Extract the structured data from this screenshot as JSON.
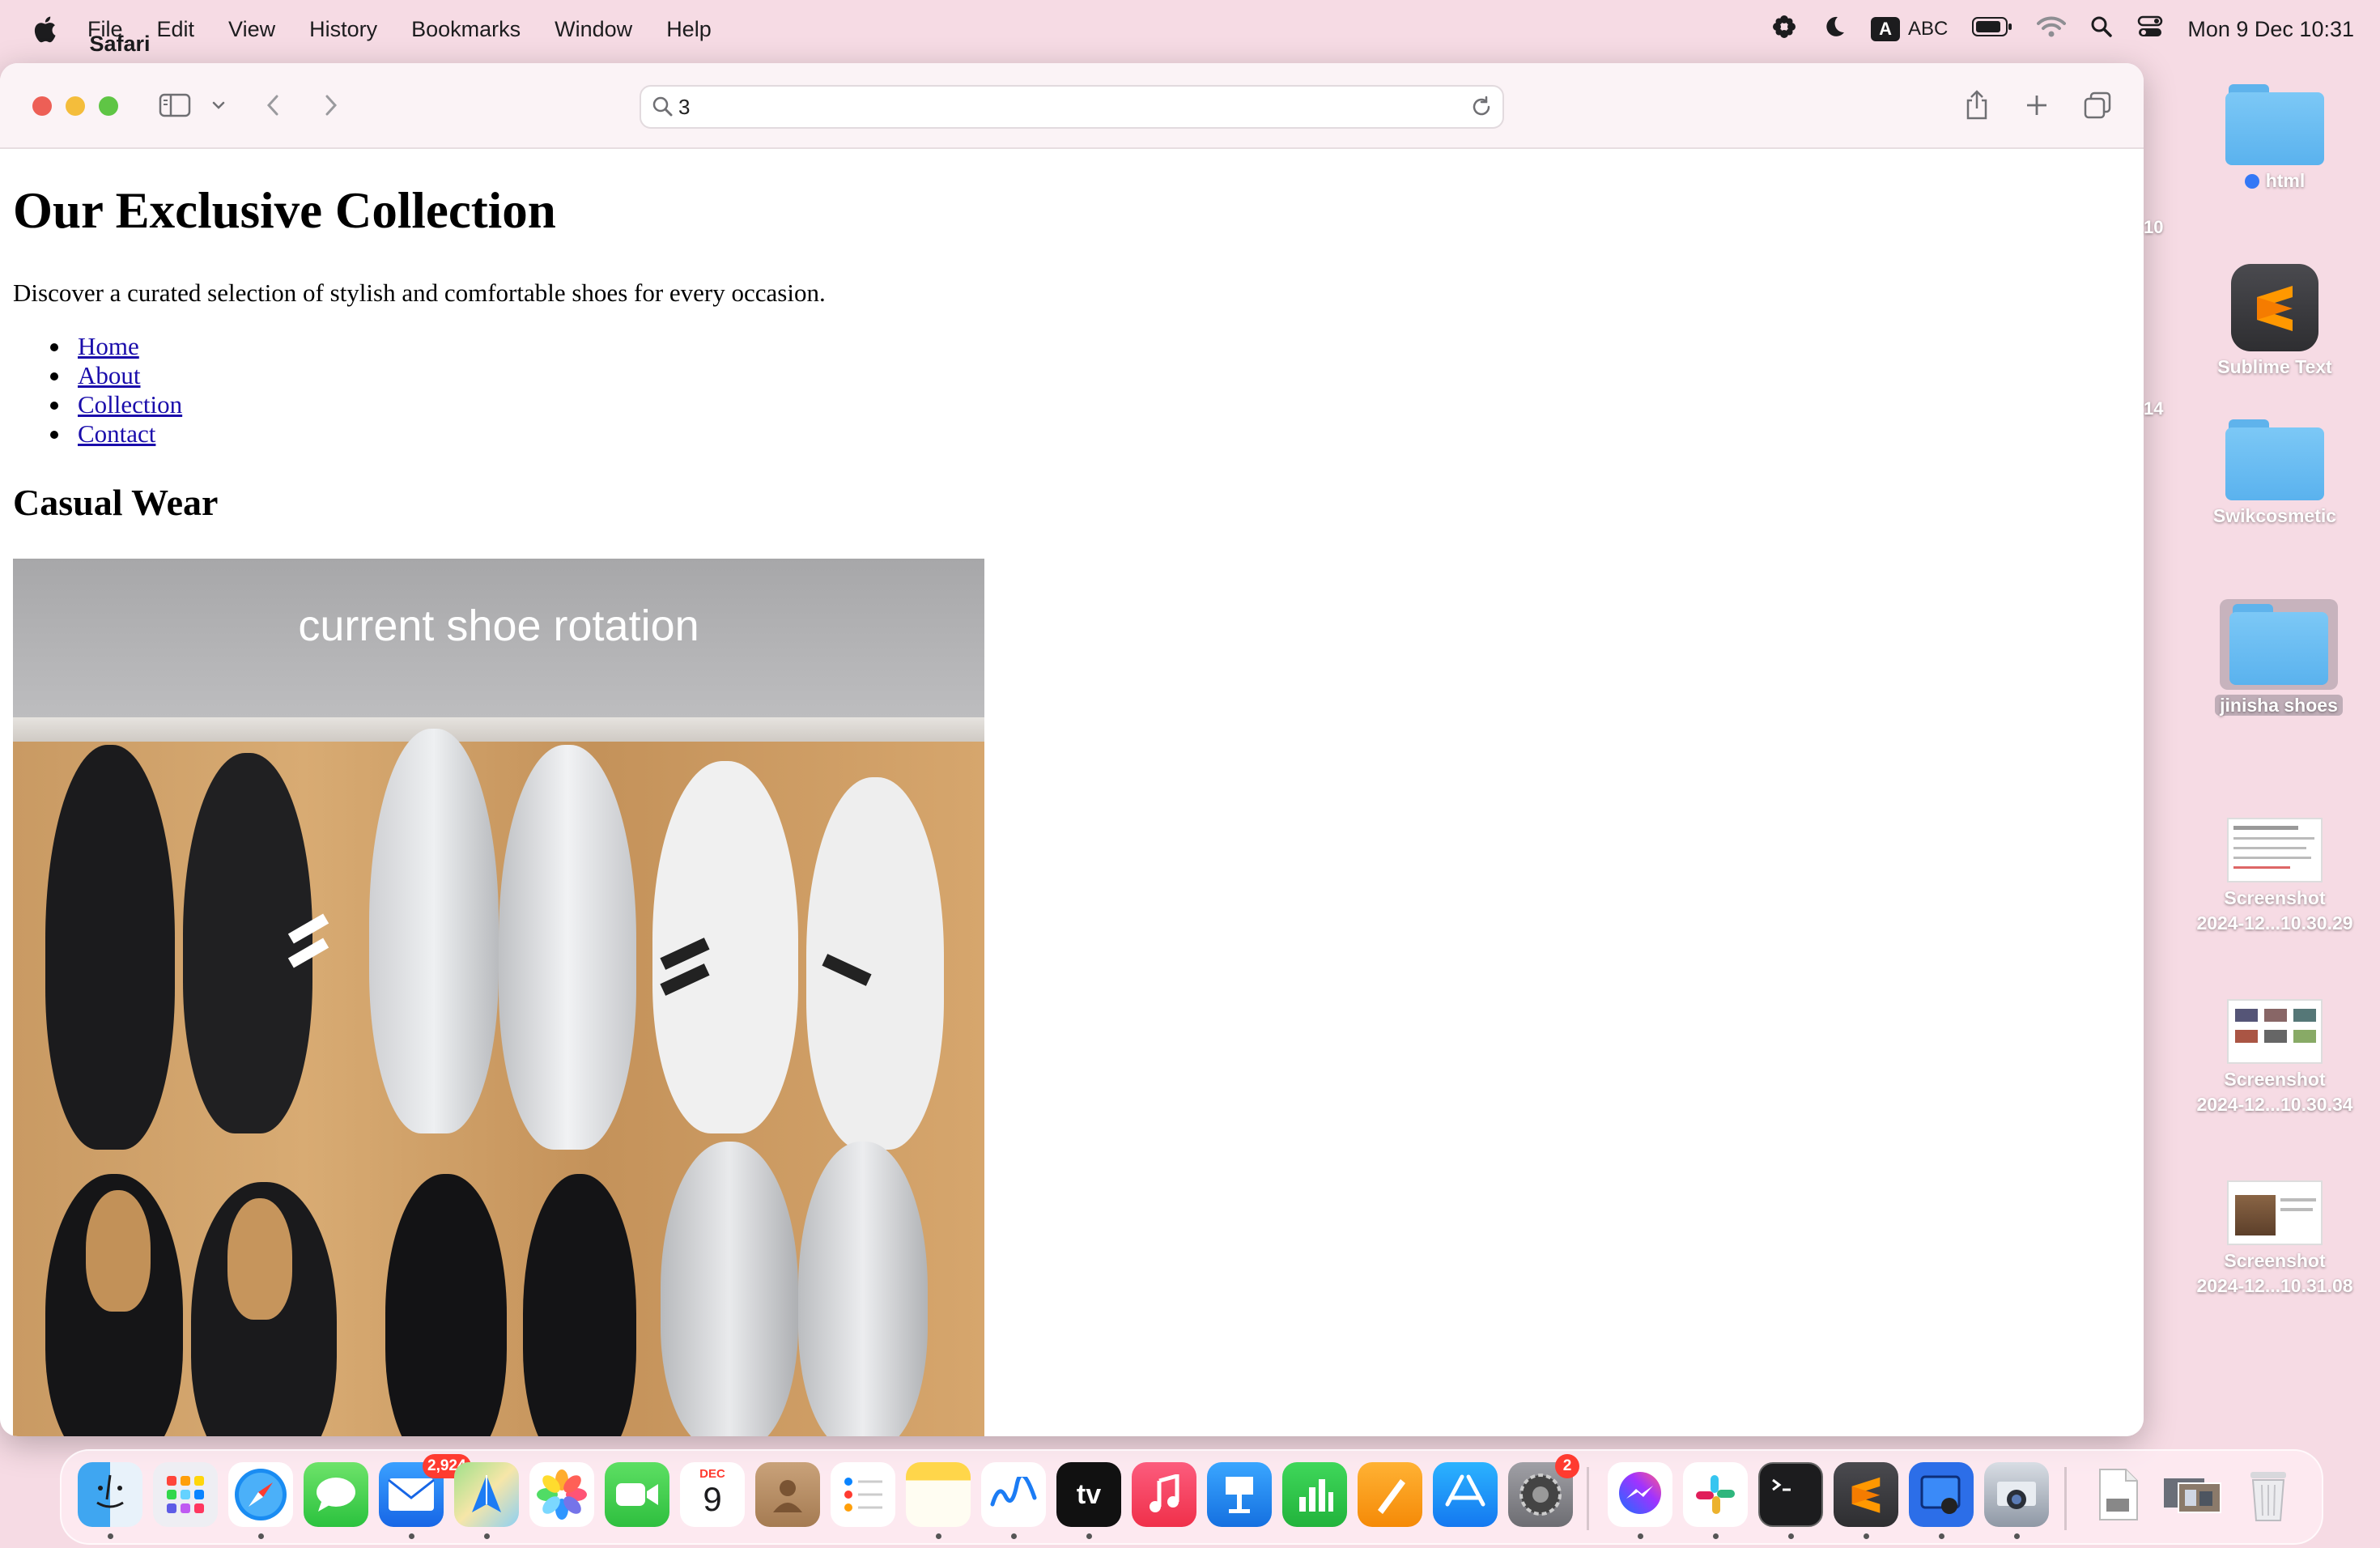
{
  "menubar": {
    "app_name": "Safari",
    "menus": [
      "File",
      "Edit",
      "View",
      "History",
      "Bookmarks",
      "Window",
      "Help"
    ],
    "keyboard_badge": "A",
    "keyboard_label": "ABC",
    "clock": "Mon 9 Dec  10:31"
  },
  "safari": {
    "address_text": "3"
  },
  "page": {
    "title": "Our Exclusive Collection",
    "tagline": "Discover a curated selection of stylish and comfortable shoes for every occasion.",
    "nav": [
      "Home",
      "About",
      "Collection",
      "Contact"
    ],
    "section_title": "Casual Wear",
    "image_caption": "current shoe rotation"
  },
  "desktop": {
    "items": [
      {
        "label": "html",
        "kind": "folder"
      },
      {
        "label": "Sublime Text",
        "kind": "app"
      },
      {
        "label": "Swikcosmetic",
        "kind": "folder"
      },
      {
        "label": "jinisha shoes",
        "kind": "folder"
      },
      {
        "label": "Screenshot\n2024-12...10.30.29",
        "kind": "screenshot"
      },
      {
        "label": "Screenshot\n2024-12...10.30.34",
        "kind": "screenshot"
      },
      {
        "label": "Screenshot\n2024-12...10.31.08",
        "kind": "screenshot"
      }
    ],
    "clipped_labels": [
      "10",
      "14"
    ]
  },
  "dock": {
    "mail_badge": "2,924",
    "calendar_month": "DEC",
    "calendar_day": "9",
    "settings_badge": "2",
    "tv_label": "tv",
    "apps": [
      "finder",
      "launchpad",
      "safari",
      "messages",
      "mail",
      "maps",
      "photos",
      "facetime",
      "calendar",
      "contacts",
      "reminders",
      "notes",
      "freeform",
      "tv",
      "music",
      "keynote",
      "numbers",
      "pages",
      "app-store",
      "system-settings",
      "messenger",
      "slack",
      "terminal",
      "sublime-text",
      "preview",
      "screenshot-app",
      "document",
      "photo-stack",
      "trash"
    ]
  }
}
